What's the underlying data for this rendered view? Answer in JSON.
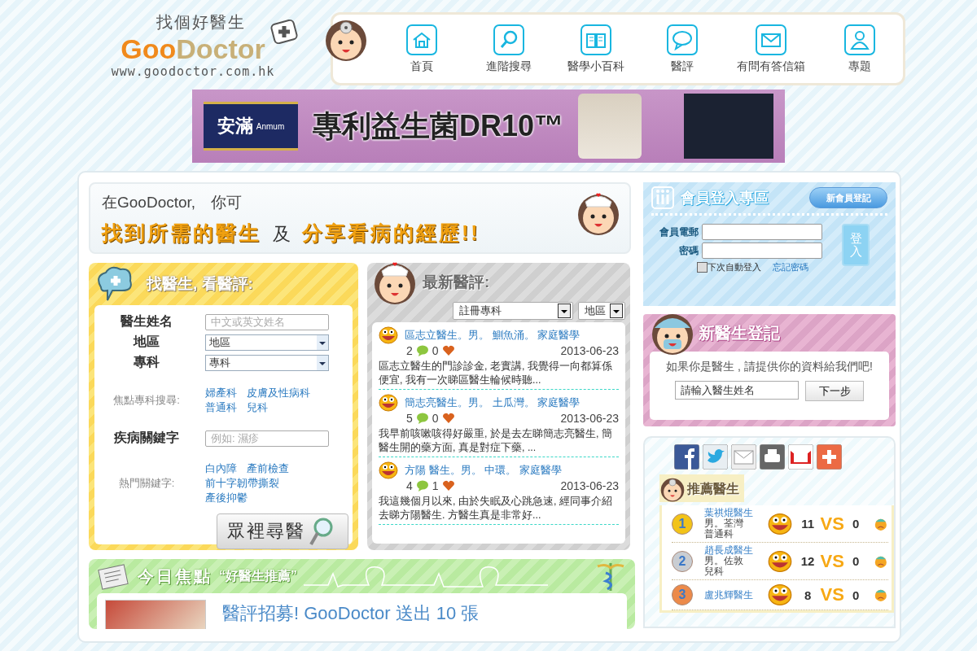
{
  "site": {
    "tagline": "找個好醫生",
    "logo_goo": "Goo",
    "logo_doctor": "Doctor",
    "url": "www.goodoctor.com.hk"
  },
  "nav": [
    {
      "label": "首頁"
    },
    {
      "label": "進階搜尋"
    },
    {
      "label": "醫學小百科"
    },
    {
      "label": "醫評"
    },
    {
      "label": "有問有答信箱"
    },
    {
      "label": "專題"
    }
  ],
  "ad": {
    "brand": "安滿",
    "brand_en": "Anmum",
    "headline": "專利益生菌DR10™"
  },
  "intro": {
    "line1": "在GooDoctor,　你可",
    "highlight1": "找到所需的醫生",
    "joiner": "及",
    "highlight2": "分享看病的經歷!!"
  },
  "search": {
    "title": "找醫生, 看醫評:",
    "fields": [
      {
        "kind": "text",
        "label": "醫生姓名",
        "placeholder": "中文或英文姓名"
      },
      {
        "kind": "select",
        "label": "地區",
        "value": "地區"
      },
      {
        "kind": "select",
        "label": "專科",
        "value": "專科"
      }
    ],
    "focus_label": "焦點專科搜尋:",
    "focus_links": [
      "婦產科",
      "皮膚及性病科",
      "普通科",
      "兒科"
    ],
    "keyword_label": "疾病關鍵字",
    "keyword_placeholder": "例如: 濕疹",
    "hot_label": "熱門關鍵字:",
    "hot_links": [
      "白內障",
      "產前檢查",
      "前十字韌帶撕裂",
      "產後抑鬱"
    ],
    "button": "眾裡尋醫"
  },
  "reviews": {
    "title": "最新醫評:",
    "filters": [
      "註冊專科",
      "地區"
    ],
    "items": [
      {
        "heading": "區志立醫生。男。 鰂魚涌。 家庭醫學",
        "comments": "2",
        "likes": "0",
        "date": "2013-06-23",
        "excerpt": "區志立醫生的門診診金, 老實講, 我覺得一向都算係便宜, 我有一次睇區醫生輪候時聽..."
      },
      {
        "heading": "簡志亮醫生。男。 土瓜灣。 家庭醫學",
        "comments": "5",
        "likes": "0",
        "date": "2013-06-23",
        "excerpt": "我早前咳嗽咳得好嚴重, 於是去左睇簡志亮醫生, 簡醫生開的藥方面, 真是對症下藥, ..."
      },
      {
        "heading": "方陽 醫生。男。 中環。 家庭醫學",
        "comments": "4",
        "likes": "1",
        "date": "2013-06-23",
        "excerpt": "我這幾個月以來, 由於失眠及心跳急速, 經同事介紹去睇方陽醫生. 方醫生真是非常好..."
      }
    ]
  },
  "focus": {
    "title": "今日焦點",
    "subtitle": "“好醫生推薦”",
    "headline": "醫評招募! GooDoctor 送出 10 張"
  },
  "login": {
    "title": "會員登入專區",
    "register": "新會員登記",
    "email_label": "會員電郵",
    "password_label": "密碼",
    "remember_label": "下次自動登入",
    "remember_checked": false,
    "forgot": "忘記密碼",
    "submit": "登入"
  },
  "new_doctor": {
    "title": "新醫生登記",
    "prompt": "如果你是醫生 , 請提供你的資料給我們吧!",
    "value": "請輸入醫生姓名",
    "button": "下一步"
  },
  "recommend": {
    "title": "推薦醫生",
    "doctors": [
      {
        "rank": "1",
        "color": "#f2c318",
        "name": "葉祺焜醫生",
        "details": "男。荃灣",
        "specialty": "普通科",
        "good": "11",
        "vs": "VS",
        "bad": "0"
      },
      {
        "rank": "2",
        "color": "#c9cdd2",
        "name": "趙長成醫生",
        "details": "男。佐敦",
        "specialty": "兒科",
        "good": "12",
        "vs": "VS",
        "bad": "0"
      },
      {
        "rank": "3",
        "color": "#ec8a4a",
        "name": "盧兆輝醫生",
        "good": "8",
        "vs": "VS",
        "bad": "0"
      }
    ]
  }
}
